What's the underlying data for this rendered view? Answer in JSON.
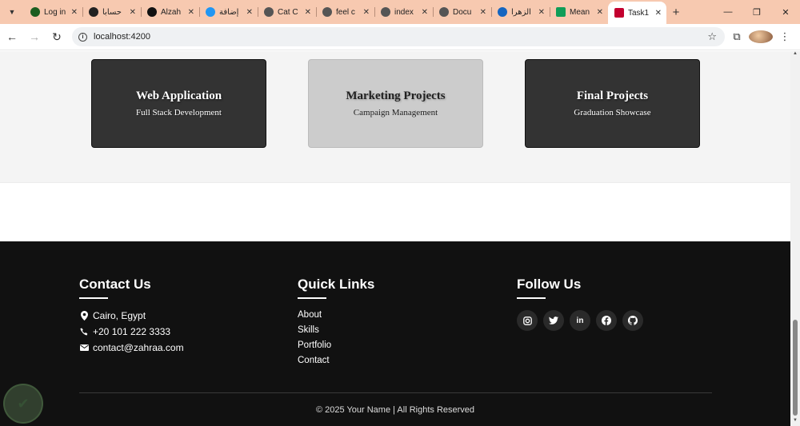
{
  "browser": {
    "tabs": [
      {
        "title": "Log in",
        "favicon_color": "#1b5e20"
      },
      {
        "title": "حسابا",
        "favicon_color": "#222222"
      },
      {
        "title": "Alzah",
        "favicon_color": "#111111"
      },
      {
        "title": "إضافة",
        "favicon_color": "#2196f3"
      },
      {
        "title": "Cat C",
        "favicon_color": "#555555"
      },
      {
        "title": "feel c",
        "favicon_color": "#555555"
      },
      {
        "title": "index",
        "favicon_color": "#555555"
      },
      {
        "title": "Docu",
        "favicon_color": "#555555"
      },
      {
        "title": "الزهرا",
        "favicon_color": "#1565c0"
      },
      {
        "title": "Mean",
        "favicon_color": "#0f9d58"
      },
      {
        "title": "Task1",
        "favicon_color": "#c3002f"
      }
    ],
    "url": "localhost:4200"
  },
  "projects": {
    "cards": [
      {
        "title": "Web Application",
        "subtitle": "Full Stack Development"
      },
      {
        "title": "Marketing Projects",
        "subtitle": "Campaign Management"
      },
      {
        "title": "Final Projects",
        "subtitle": "Graduation Showcase"
      }
    ]
  },
  "footer": {
    "contact": {
      "heading": "Contact Us",
      "location": "Cairo, Egypt",
      "phone": "+20 101 222 3333",
      "email": "contact@zahraa.com"
    },
    "quick_links": {
      "heading": "Quick Links",
      "links": [
        "About",
        "Skills",
        "Portfolio",
        "Contact"
      ]
    },
    "follow": {
      "heading": "Follow Us",
      "icons": [
        "instagram-icon",
        "twitter-icon",
        "linkedin-icon",
        "facebook-icon",
        "github-icon"
      ]
    },
    "copyright": "© 2025 Your Name | All Rights Reserved"
  }
}
